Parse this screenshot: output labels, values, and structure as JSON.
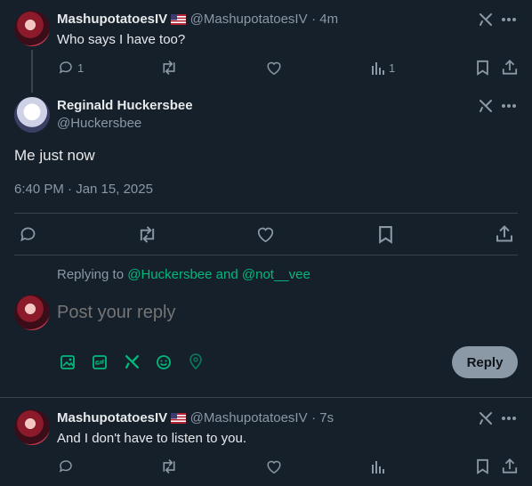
{
  "post1": {
    "name": "MashupotatoesIV",
    "handle": "@MashupotatoesIV",
    "time": "· 4m",
    "text": "Who says I have too?",
    "reply_count": "1",
    "views_count": "1"
  },
  "main_post": {
    "name": "Reginald Huckersbee",
    "handle": "@Huckersbee",
    "text": "Me just now",
    "timestamp": "6:40 PM · Jan 15, 2025"
  },
  "reply_box": {
    "replying_prefix": "Replying to",
    "replying_user1": "@Huckersbee",
    "replying_and": "and",
    "replying_user2": "@not__vee",
    "placeholder": "Post your reply",
    "button_label": "Reply"
  },
  "post3": {
    "name": "MashupotatoesIV",
    "handle": "@MashupotatoesIV",
    "time": "· 7s",
    "text": "And I don't have to listen to you."
  },
  "colors": {
    "background": "#15202b",
    "accent_green": "#00ba7c",
    "muted": "#8b98a5",
    "reply_button": "#8b98a5"
  },
  "icons": [
    "reply-icon",
    "repost-icon",
    "like-icon",
    "views-icon",
    "bookmark-icon",
    "share-icon",
    "grok-icon",
    "more-icon",
    "image-icon",
    "gif-icon",
    "emoji-icon",
    "location-icon",
    "flag-icon"
  ]
}
